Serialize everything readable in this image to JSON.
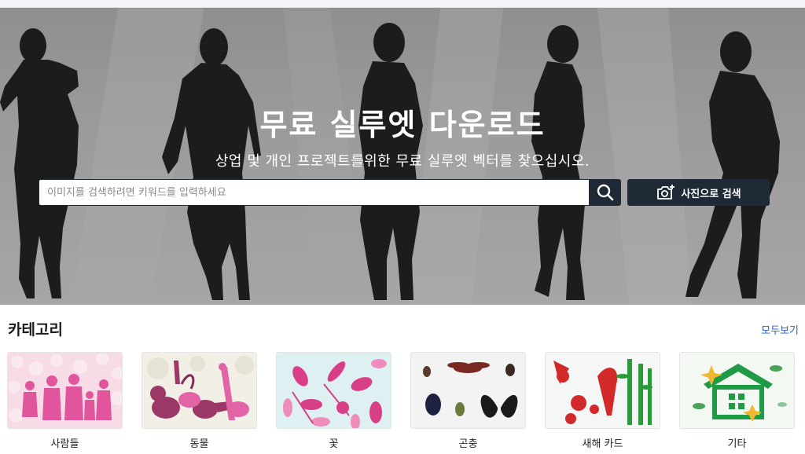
{
  "hero": {
    "title": "무료 실루엣 다운로드",
    "subtitle": "상업 및 개인 프로젝트를위한 무료 실루엣 벡터를 찾으십시오."
  },
  "search": {
    "placeholder": "이미지를 검색하려면 키워드를 입력하세요",
    "value": "",
    "button_icon": "search-icon",
    "photo_search_label": "사진으로 검색",
    "photo_search_icon": "camera-plus-icon"
  },
  "categories": {
    "title": "카테고리",
    "view_all": "모두보기",
    "items": [
      {
        "label": "사람들"
      },
      {
        "label": "동물"
      },
      {
        "label": "꽃"
      },
      {
        "label": "곤충"
      },
      {
        "label": "새해 카드"
      },
      {
        "label": "기타"
      }
    ]
  },
  "colors": {
    "dark_button": "#1f2a36",
    "link": "#2b5bd7",
    "hero_gray": "#9c9c9c"
  }
}
